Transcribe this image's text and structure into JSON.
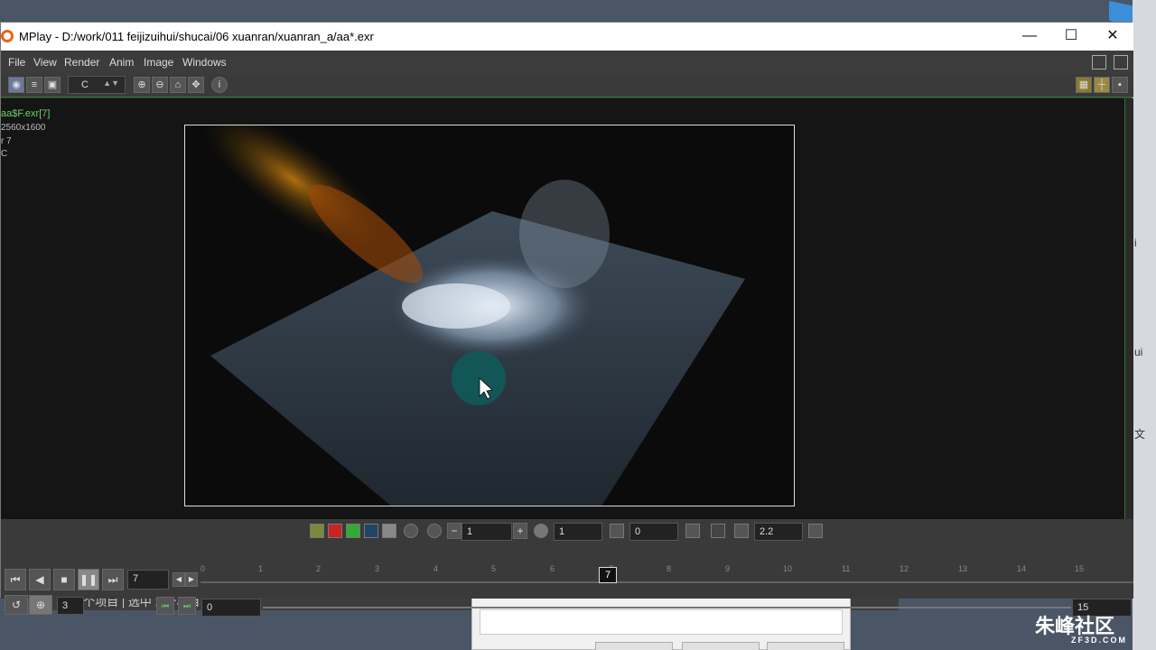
{
  "window": {
    "title": "MPlay - D:/work/011 feijizuihui/shucai/06 xuanran/xuanran_a/aa*.exr",
    "minimize": "—",
    "maximize": "☐",
    "close": "✕"
  },
  "menu": [
    "File",
    "View",
    "Render",
    "Anim",
    "Image",
    "Windows"
  ],
  "toolbar": {
    "channel": "C"
  },
  "info": {
    "sequence": "aa$F.exr[7]",
    "resolution": "2560x1600",
    "frame": "r 7",
    "extra": "C"
  },
  "colors": {
    "viewport_bg": "#151515",
    "accent_green": "#2b7a2b",
    "info_green": "#6fd06f"
  },
  "display": {
    "layer_value": "1",
    "exposure_value": "1",
    "gamma_field": "0",
    "lut_gamma": "2.2"
  },
  "playback": {
    "current_frame": "7",
    "step": "3",
    "range_start": "0",
    "range_end": "15",
    "ticks": [
      "0",
      "1",
      "2",
      "3",
      "4",
      "5",
      "6",
      "7",
      "8",
      "9",
      "10",
      "11",
      "12",
      "13",
      "14",
      "15"
    ],
    "marker": "7"
  },
  "behind": {
    "status_text": "416 个项目  |  选中 1 个项目  1.30 MB  |",
    "right_chars": [
      "i",
      "ui",
      "文"
    ]
  },
  "watermark": {
    "brand": "朱峰社区",
    "url": "ZF3D.COM"
  }
}
